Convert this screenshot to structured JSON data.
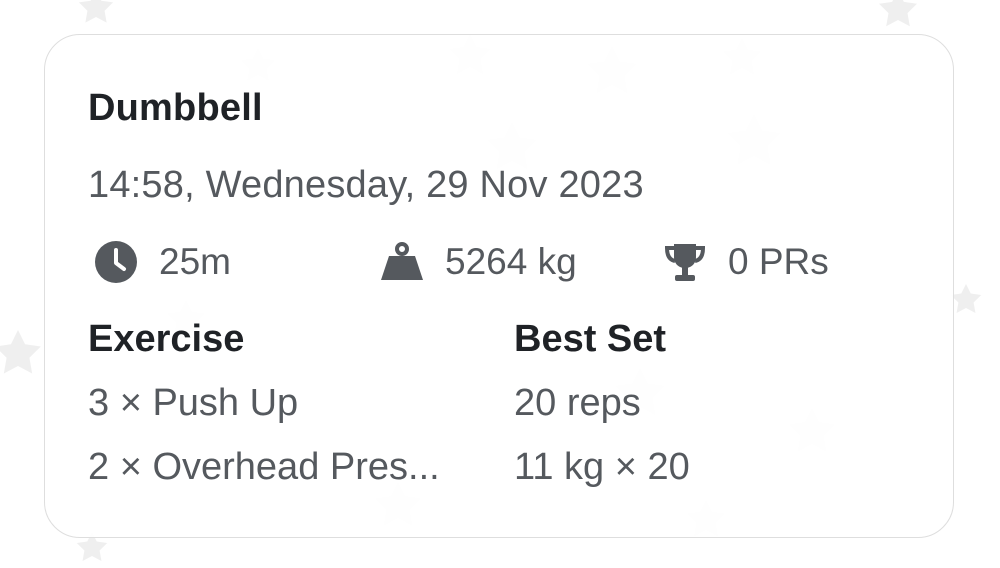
{
  "workout": {
    "title": "Dumbbell",
    "datetime": "14:58, Wednesday, 29 Nov 2023"
  },
  "stats": {
    "duration": {
      "icon": "clock-icon",
      "value": "25m"
    },
    "volume": {
      "icon": "weight-icon",
      "value": "5264 kg"
    },
    "prs": {
      "icon": "trophy-icon",
      "value": "0 PRs"
    }
  },
  "table": {
    "headers": {
      "exercise": "Exercise",
      "best_set": "Best Set"
    },
    "rows": [
      {
        "exercise": "3 × Push Up",
        "best_set": "20 reps"
      },
      {
        "exercise": "2 × Overhead Pres...",
        "best_set": "11 kg × 20"
      }
    ]
  },
  "colors": {
    "title": "#1f2226",
    "secondary_text": "#55595e",
    "icon": "#55595e",
    "card_border": "#dedede",
    "background_stars": "#eeeeee"
  }
}
